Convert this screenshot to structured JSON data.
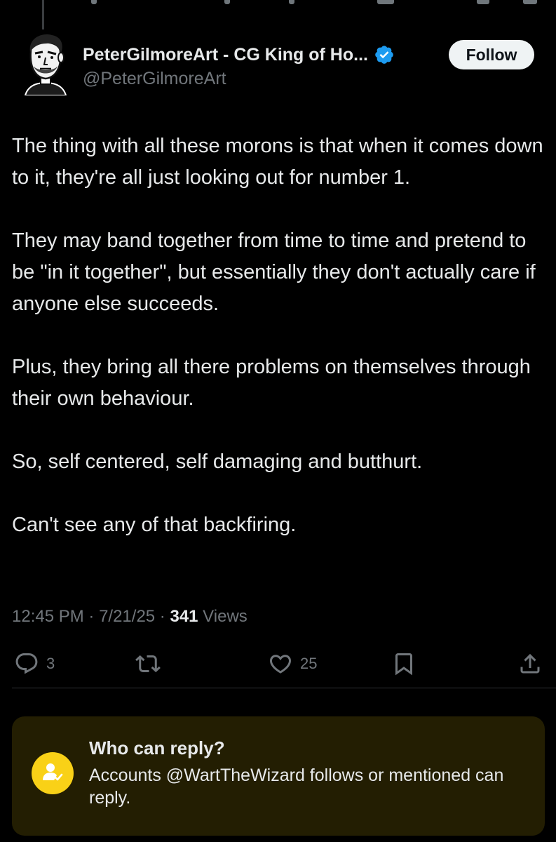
{
  "author": {
    "display_name": "PeterGilmoreArt - CG King of Ho...",
    "handle": "@PeterGilmoreArt",
    "verified_icon": "verified-badge-icon",
    "avatar_icon": "cartoon-avatar"
  },
  "follow_label": "Follow",
  "tweet": {
    "paragraphs": [
      "The thing with all these morons is that when it comes down to it, they're all just looking out for number 1.",
      "They may band together from time to time and pretend to be \"in it together\", but essentially they don't actually care if anyone else succeeds.",
      "Plus, they bring all there problems on themselves through their own behaviour.",
      "So, self centered, self damaging and butthurt.",
      "Can't see any of that backfiring."
    ]
  },
  "meta": {
    "time": "12:45 PM",
    "sep1": " · ",
    "date": "7/21/25",
    "sep2": " · ",
    "views_count": "341",
    "views_label": " Views"
  },
  "actions": {
    "reply_count": "3",
    "like_count": "25"
  },
  "reply_restriction": {
    "title": "Who can reply?",
    "text": "Accounts @WartTheWizard follows or mentioned can reply."
  },
  "colors": {
    "background": "#000000",
    "text": "#e7e9ea",
    "muted": "#71767b",
    "verified": "#1d9bf0",
    "card_bg": "#231e02",
    "card_icon": "#f9d117"
  }
}
